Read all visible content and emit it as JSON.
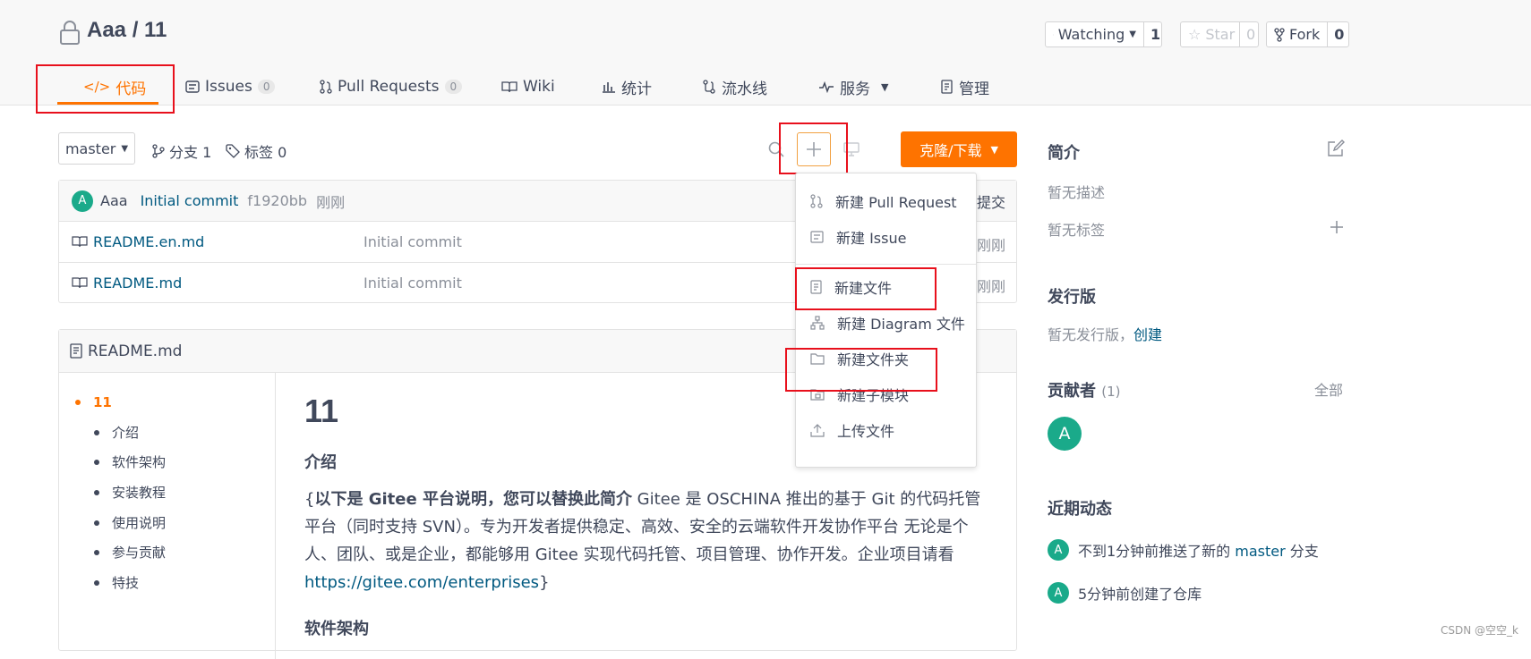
{
  "repo": {
    "title": "Aaa / 11"
  },
  "actions": {
    "watch_label": "Watching",
    "watch_count": "1",
    "star_label": "Star",
    "star_count": "0",
    "fork_label": "Fork",
    "fork_count": "0"
  },
  "tabs": [
    {
      "label": "代码",
      "active": true
    },
    {
      "label": "Issues",
      "badge": "0"
    },
    {
      "label": "Pull Requests",
      "badge": "0"
    },
    {
      "label": "Wiki"
    },
    {
      "label": "统计"
    },
    {
      "label": "流水线"
    },
    {
      "label": "服务"
    },
    {
      "label": "管理"
    }
  ],
  "toolbar": {
    "branch": "master",
    "branches": "分支 1",
    "tags": "标签 0",
    "clone_label": "克隆/下载"
  },
  "commit": {
    "avatar": "A",
    "author": "Aaa",
    "message": "Initial commit",
    "hash": "f1920bb",
    "time": "刚刚",
    "extra": "提交"
  },
  "files": [
    {
      "name": "README.en.md",
      "message": "Initial commit",
      "time": "刚刚"
    },
    {
      "name": "README.md",
      "message": "Initial commit",
      "time": "刚刚"
    }
  ],
  "readme": {
    "header": "README.md",
    "toc": [
      "11",
      "介绍",
      "软件架构",
      "安装教程",
      "使用说明",
      "参与贡献",
      "特技"
    ],
    "h1": "11",
    "h2": "介绍",
    "p_bold": "以下是 Gitee 平台说明，您可以替换此简介",
    "p_open": "{",
    "p_text": " Gitee 是 OSCHINA 推出的基于 Git 的代码托管平台（同时支持 SVN）。专为开发者提供稳定、高效、安全的云端软件开发协作平台 无论是个人、团队、或是企业，都能够用 Gitee 实现代码托管、项目管理、协作开发。企业项目请看 ",
    "p_link": "https://gitee.com/enterprises",
    "p_close": "}",
    "h2_next": "软件架构"
  },
  "dropdown": {
    "items": [
      "新建 Pull Request",
      "新建 Issue",
      "新建文件",
      "新建 Diagram 文件",
      "新建文件夹",
      "新建子模块",
      "上传文件"
    ]
  },
  "sidebar": {
    "intro_title": "简介",
    "intro_desc": "暂无描述",
    "intro_tags": "暂无标签",
    "release_title": "发行版",
    "release_text": "暂无发行版，",
    "release_link": "创建",
    "contrib_title": "贡献者",
    "contrib_count": "(1)",
    "contrib_all": "全部",
    "contrib_avatar": "A",
    "activity_title": "近期动态",
    "activity": [
      {
        "avatar": "A",
        "pre": "不到1分钟前推送了新的 ",
        "link": "master",
        "post": " 分支"
      },
      {
        "avatar": "A",
        "pre": "5分钟前创建了仓库",
        "link": "",
        "post": ""
      }
    ]
  },
  "watermark": "CSDN @空空_k",
  "colors": {
    "accent": "#fe7300",
    "link": "#005980",
    "highlight": "#e8101c",
    "avatar": "#1aaa8a"
  }
}
